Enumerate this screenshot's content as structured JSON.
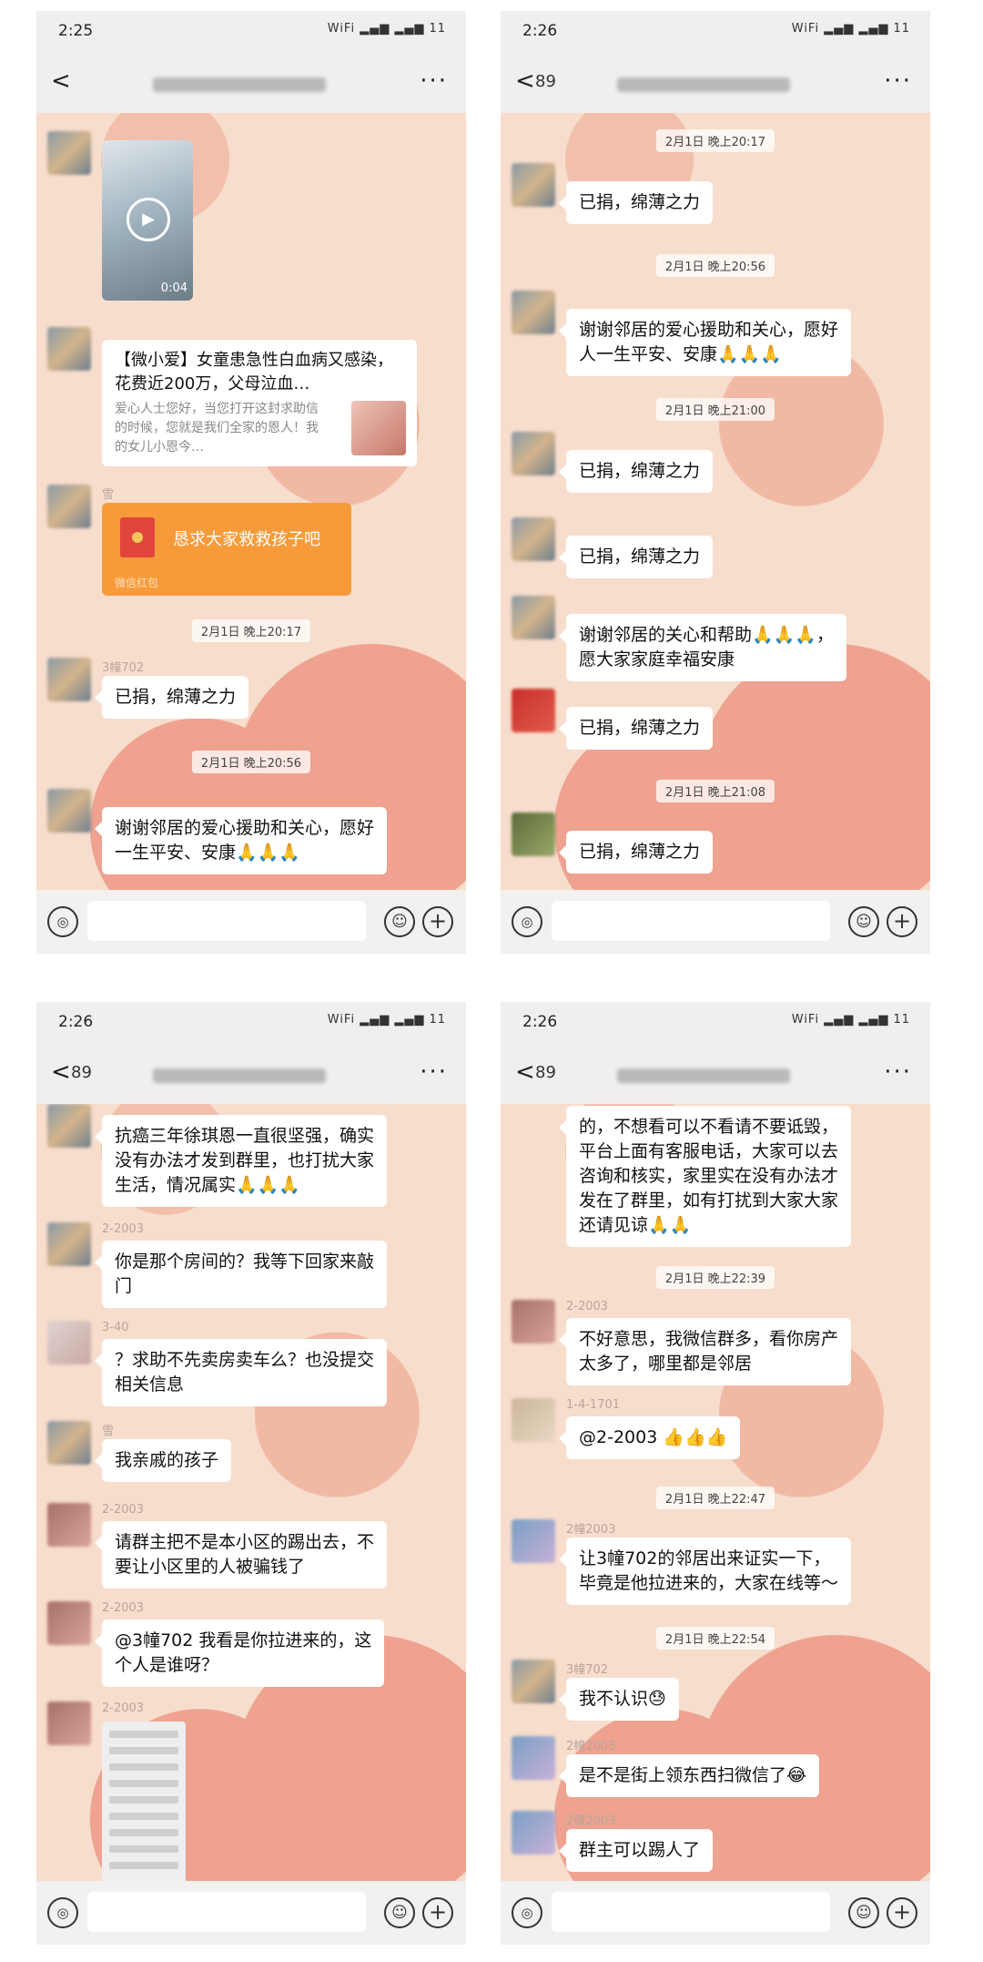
{
  "phones": [
    {
      "time": "2:25",
      "status_icons": "WiFi ▂▄▆ ▂▄▆ 11",
      "back": "<",
      "badge": "",
      "more": "···",
      "video_duration": "0:04",
      "link_title": "【微小爱】女童患急性白血病又感染，花费近200万，父母泣血…",
      "link_desc": "爱心人士您好，当您打开这封求助信的时候，您就是我们全家的恩人！我的女儿小恩今…",
      "redpacket_title": "恳求大家救救孩子吧",
      "redpacket_sub": "微信红包",
      "nick_red": "雪",
      "ts1": "2月1日 晚上20:17",
      "nick_702": "3幢702",
      "msg1": "已捐，绵薄之力",
      "ts2": "2月1日 晚上20:56",
      "msg2a": "谢谢邻居的爱心援助和关心，愿好",
      "msg2b": "一生平安、安康🙏🙏🙏"
    },
    {
      "time": "2:26",
      "status_icons": "WiFi ▂▄▆ ▂▄▆ 11",
      "back": "<",
      "badge": "89",
      "more": "···",
      "ts1": "2月1日 晚上20:17",
      "msg1": "已捐，绵薄之力",
      "ts2": "2月1日 晚上20:56",
      "msg2a": "谢谢邻居的爱心援助和关心，愿好",
      "msg2b": "人一生平安、安康🙏🙏🙏",
      "ts3": "2月1日 晚上21:00",
      "msg3": "已捐，绵薄之力",
      "msg4": "已捐，绵薄之力",
      "msg5a": "谢谢邻居的关心和帮助🙏🙏🙏，",
      "msg5b": "愿大家家庭幸福安康",
      "msg6": "已捐，绵薄之力",
      "ts4": "2月1日 晚上21:08",
      "msg7": "已捐，绵薄之力"
    },
    {
      "time": "2:26",
      "status_icons": "WiFi ▂▄▆ ▂▄▆ 11",
      "back": "<",
      "badge": "89",
      "more": "···",
      "msg1a": "抗癌三年徐琪恩一直很坚强，确实",
      "msg1b": "没有办法才发到群里，也打扰大家",
      "msg1c": "生活，情况属实🙏🙏🙏",
      "nick2": "2-2003",
      "msg2a": "你是那个房间的？我等下回家来敲",
      "msg2b": "门",
      "nick3": "3-40",
      "msg3a": "？求助不先卖房卖车么？也没提交",
      "msg3b": "相关信息",
      "nick4": "雪",
      "msg4": "我亲戚的孩子",
      "nick5": "2-2003",
      "msg5a": "请群主把不是本小区的踢出去，不",
      "msg5b": "要让小区里的人被骗钱了",
      "nick6": "2-2003",
      "msg6a": "@3幢702 我看是你拉进来的，这",
      "msg6b": "个人是谁呀？",
      "nick7": "2-2003"
    },
    {
      "time": "2:26",
      "status_icons": "WiFi ▂▄▆ ▂▄▆ 11",
      "back": "<",
      "badge": "89",
      "more": "···",
      "msg1a": "的，不想看可以不看请不要诋毁，",
      "msg1b": "平台上面有客服电话，大家可以去",
      "msg1c": "咨询和核实，家里实在没有办法才",
      "msg1d": "发在了群里，如有打扰到大家大家",
      "msg1e": "还请见谅🙏🙏",
      "ts1": "2月1日 晚上22:39",
      "nick2": "2-2003",
      "msg2a": "不好意思，我微信群多，看你房产",
      "msg2b": "太多了，哪里都是邻居",
      "nick3": "1-4-1701",
      "msg3": "@2-2003 👍👍👍",
      "ts2": "2月1日 晚上22:47",
      "nick4": "2幢2003",
      "msg4a": "让3幢702的邻居出来证实一下，",
      "msg4b": "毕竟是他拉进来的，大家在线等～",
      "ts3": "2月1日 晚上22:54",
      "nick5": "3幢702",
      "msg5": "我不认识😓",
      "nick6": "2幢2003",
      "msg6": "是不是街上领东西扫微信了😂",
      "nick7": "2幢2003",
      "msg7": "群主可以踢人了"
    }
  ],
  "input": {
    "voice_icon": "◎",
    "emoji_icon": "☺",
    "plus_icon": "+"
  }
}
